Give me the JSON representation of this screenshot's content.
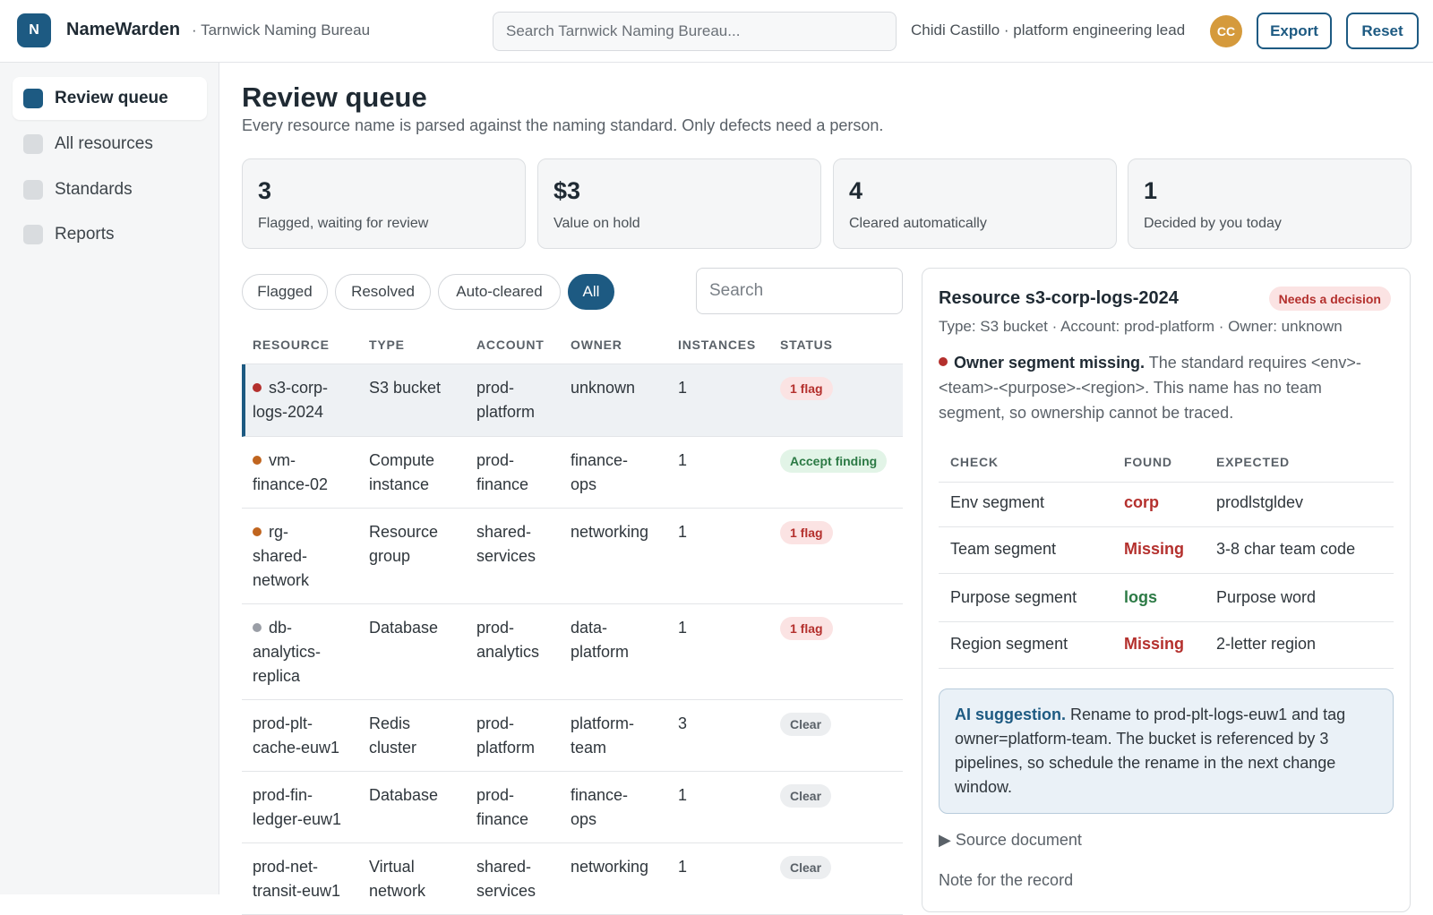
{
  "app": {
    "logo_letter": "N",
    "name": "NameWarden",
    "org": "· Tarnwick Naming Bureau",
    "search_placeholder": "Search Tarnwick Naming Bureau...",
    "user": "Chidi Castillo · platform engineering lead",
    "avatar_initials": "CC",
    "export_label": "Export",
    "reset_label": "Reset"
  },
  "sidebar": {
    "items": [
      {
        "label": "Review queue",
        "active": true
      },
      {
        "label": "All resources",
        "active": false
      },
      {
        "label": "Standards",
        "active": false
      },
      {
        "label": "Reports",
        "active": false
      }
    ]
  },
  "page": {
    "title": "Review queue",
    "subtitle": "Every resource name is parsed against the naming standard. Only defects need a person."
  },
  "stats": [
    {
      "value": "3",
      "label": "Flagged, waiting for review"
    },
    {
      "value": "$3",
      "label": "Value on hold"
    },
    {
      "value": "4",
      "label": "Cleared automatically"
    },
    {
      "value": "1",
      "label": "Decided by you today"
    }
  ],
  "filters": [
    {
      "label": "Flagged",
      "active": false
    },
    {
      "label": "Resolved",
      "active": false
    },
    {
      "label": "Auto-cleared",
      "active": false
    },
    {
      "label": "All",
      "active": true
    }
  ],
  "table_search_placeholder": "Search",
  "table": {
    "headers": [
      "RESOURCE",
      "TYPE",
      "ACCOUNT",
      "OWNER",
      "INSTANCES",
      "STATUS"
    ],
    "rows": [
      {
        "resource_l1": "s3-corp-",
        "resource_l2": "logs-2024",
        "resource_l3": "",
        "dot": "#b4302d",
        "type_l1": "S3 bucket",
        "type_l2": "",
        "account_l1": "prod-",
        "account_l2": "platform",
        "owner_l1": "unknown",
        "owner_l2": "",
        "instances": "1",
        "status": "1 flag",
        "status_kind": "flag"
      },
      {
        "resource_l1": "vm-",
        "resource_l2": "finance-02",
        "resource_l3": "",
        "dot": "#c0651f",
        "type_l1": "Compute",
        "type_l2": "instance",
        "account_l1": "prod-",
        "account_l2": "finance",
        "owner_l1": "finance-",
        "owner_l2": "ops",
        "instances": "1",
        "status": "Accept finding",
        "status_kind": "accept"
      },
      {
        "resource_l1": "rg-",
        "resource_l2": "shared-",
        "resource_l3": "network",
        "dot": "#c0651f",
        "type_l1": "Resource",
        "type_l2": "group",
        "account_l1": "shared-",
        "account_l2": "services",
        "owner_l1": "networking",
        "owner_l2": "",
        "instances": "1",
        "status": "1 flag",
        "status_kind": "flag"
      },
      {
        "resource_l1": "db-",
        "resource_l2": "analytics-",
        "resource_l3": "replica",
        "dot": "#9a9ea6",
        "type_l1": "Database",
        "type_l2": "",
        "account_l1": "prod-",
        "account_l2": "analytics",
        "owner_l1": "data-",
        "owner_l2": "platform",
        "instances": "1",
        "status": "1 flag",
        "status_kind": "flag"
      },
      {
        "resource_l1": "prod-plt-",
        "resource_l2": "cache-euw1",
        "resource_l3": "",
        "dot": "",
        "type_l1": "Redis",
        "type_l2": "cluster",
        "account_l1": "prod-",
        "account_l2": "platform",
        "owner_l1": "platform-",
        "owner_l2": "team",
        "instances": "3",
        "status": "Clear",
        "status_kind": "clear"
      },
      {
        "resource_l1": "prod-fin-",
        "resource_l2": "ledger-euw1",
        "resource_l3": "",
        "dot": "",
        "type_l1": "Database",
        "type_l2": "",
        "account_l1": "prod-",
        "account_l2": "finance",
        "owner_l1": "finance-",
        "owner_l2": "ops",
        "instances": "1",
        "status": "Clear",
        "status_kind": "clear"
      },
      {
        "resource_l1": "prod-net-",
        "resource_l2": "transit-euw1",
        "resource_l3": "",
        "dot": "",
        "type_l1": "Virtual",
        "type_l2": "network",
        "account_l1": "shared-",
        "account_l2": "services",
        "owner_l1": "networking",
        "owner_l2": "",
        "instances": "1",
        "status": "Clear",
        "status_kind": "clear"
      }
    ]
  },
  "detail": {
    "title": "Resource s3-corp-logs-2024",
    "badge": "Needs a decision",
    "meta": "Type: S3 bucket · Account: prod-platform · Owner: unknown",
    "issue_lead": "Owner segment missing.",
    "issue_text": " The standard requires <env>-<team>-<purpose>-<region>. This name has no team segment, so ownership cannot be traced.",
    "check_headers": [
      "CHECK",
      "FOUND",
      "EXPECTED"
    ],
    "checks": [
      {
        "check": "Env segment",
        "found": "corp",
        "found_ok": false,
        "expected": "prodlstgldev"
      },
      {
        "check": "Team segment",
        "found": "Missing",
        "found_ok": false,
        "expected": "3-8 char team code"
      },
      {
        "check": "Purpose segment",
        "found": "logs",
        "found_ok": true,
        "expected": "Purpose word"
      },
      {
        "check": "Region segment",
        "found": "Missing",
        "found_ok": false,
        "expected": "2-letter region"
      }
    ],
    "ai_lead": "AI suggestion.",
    "ai_text": " Rename to prod-plt-logs-euw1 and tag owner=platform-team. The bucket is referenced by 3 pipelines, so schedule the rename in the next change window.",
    "source_label": "▶  Source document",
    "note_label": "Note for the record"
  }
}
